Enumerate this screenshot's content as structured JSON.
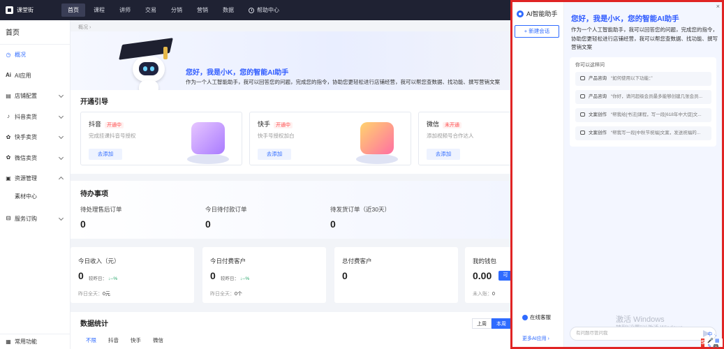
{
  "app": {
    "logo_text": "课堂街"
  },
  "topnav": {
    "items": [
      "首页",
      "课程",
      "讲师",
      "交易",
      "分销",
      "营销",
      "数据"
    ],
    "help": "帮助中心"
  },
  "sidebar": {
    "title": "首页",
    "items": [
      {
        "icon": "clock-icon",
        "label": "概况"
      },
      {
        "icon": "ai-icon",
        "label": "AI应用"
      },
      {
        "icon": "store-icon",
        "label": "店铺配置"
      },
      {
        "icon": "tiktok-icon",
        "label": "抖音卖货"
      },
      {
        "icon": "kuaishou-icon",
        "label": "快手卖货"
      },
      {
        "icon": "wechat-icon",
        "label": "微信卖货"
      },
      {
        "icon": "resource-icon",
        "label": "资源管理"
      }
    ],
    "sub_item": "素材中心",
    "service": "服务订购",
    "bottom": "常用功能"
  },
  "breadcrumb": "概况",
  "hero": {
    "title": "您好，我是小K，您的智能AI助手",
    "desc": "作为一个人工智能助手，我可以回答您的问题，完成您的指令，协助您更轻松进行店铺经营，我可以帮您查数据、找功能、撰写营销文案"
  },
  "onboarding": {
    "title": "开通引导",
    "cards": [
      {
        "name": "抖音",
        "status": "开通中",
        "desc": "完成挂课抖音号授权",
        "button": "去添加",
        "color": "#c79bff"
      },
      {
        "name": "快手",
        "status": "开通中",
        "desc": "快手号授权加白",
        "button": "去添加",
        "color": "#ff8fb4"
      },
      {
        "name": "微信",
        "status": "未开通",
        "desc": "添加视频号合作达人",
        "button": "去添加"
      }
    ]
  },
  "todo": {
    "title": "待办事项",
    "items": [
      {
        "label": "待处理售后订单",
        "value": "0"
      },
      {
        "label": "今日待付款订单",
        "value": "0"
      },
      {
        "label": "待发货订单（近30天）",
        "value": "0"
      }
    ]
  },
  "stats": [
    {
      "label": "今日收入（元）",
      "value": "0",
      "cmp_label": "较昨日：",
      "cmp_value": "--%",
      "foot_label": "昨日全天：",
      "foot_value": "0元"
    },
    {
      "label": "今日付费客户",
      "value": "0",
      "cmp_label": "较昨日：",
      "cmp_value": "--%",
      "foot_label": "昨日全天：",
      "foot_value": "0个"
    },
    {
      "label": "总付费客户",
      "value": "0"
    },
    {
      "label": "我的钱包",
      "value": "0.00",
      "foot_label": "未入账：",
      "foot_value": "0",
      "badge": "可"
    }
  ],
  "data_section": {
    "title": "数据统计",
    "ranges": [
      "上周",
      "本周"
    ],
    "tabs": [
      "不限",
      "抖音",
      "快手",
      "微信"
    ]
  },
  "ai_panel": {
    "logo": "AI智能助手",
    "new_chat": "+ 新建会话",
    "service": "在线客服",
    "more": "更多AI应用 ›",
    "title": "您好，我是小K，您的智能AI助手",
    "desc": "作为一个人工智能助手，我可以回答您的问题，完成您的指令，协助您更轻松进行店铺经营，我可以帮您查数据、找功能、撰写营销文案",
    "ask_head": "你可以这样问",
    "questions": [
      {
        "type": "产品咨询",
        "text": "“如何使用以下功能：”"
      },
      {
        "type": "产品咨询",
        "text": "“你好，请问超级会员最多能够创建几张会员..."
      },
      {
        "type": "文案创作",
        "text": "“帮我给[书法]课程，写一段[618年中大促]文..."
      },
      {
        "type": "文案创作",
        "text": "“帮我写一段[中秋节祝福]文案，发送祝福的..."
      }
    ],
    "input_placeholder": "有问题尽管问我",
    "watermark": "激活 Windows",
    "watermark_sub": "转到“设置”以激活 Windows。",
    "close": "×"
  },
  "ime": {
    "logo": "S",
    "text": "中 ·, 🎤 ▦ ✎ 🎮 ⊞"
  },
  "colors": {
    "accent": "#2f6bff",
    "topbar": "#1f2233",
    "highlight_border": "#e02424"
  }
}
